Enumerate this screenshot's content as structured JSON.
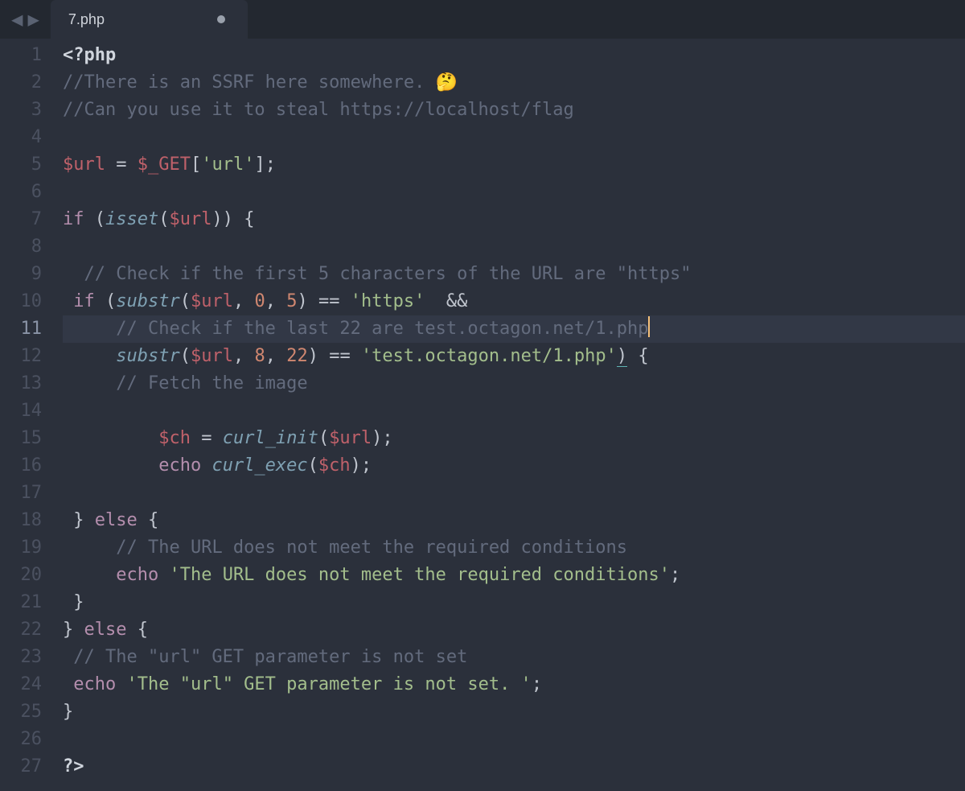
{
  "tab": {
    "filename": "7.php",
    "dirty": true
  },
  "code": {
    "active_line": 11,
    "lines": [
      {
        "n": 1,
        "tokens": [
          [
            "tag",
            "<?php"
          ]
        ]
      },
      {
        "n": 2,
        "tokens": [
          [
            "cm",
            "//There is an SSRF here somewhere. 🤔"
          ]
        ]
      },
      {
        "n": 3,
        "tokens": [
          [
            "cm",
            "//Can you use it to steal https://localhost/flag"
          ]
        ]
      },
      {
        "n": 4,
        "tokens": []
      },
      {
        "n": 5,
        "tokens": [
          [
            "var",
            "$url"
          ],
          [
            "op",
            " = "
          ],
          [
            "var",
            "$_GET"
          ],
          [
            "pn",
            "["
          ],
          [
            "str",
            "'url'"
          ],
          [
            "pn",
            "]"
          ],
          [
            "pn",
            ";"
          ]
        ]
      },
      {
        "n": 6,
        "tokens": []
      },
      {
        "n": 7,
        "tokens": [
          [
            "kw",
            "if"
          ],
          [
            "op",
            " "
          ],
          [
            "pn",
            "("
          ],
          [
            "fn",
            "isset"
          ],
          [
            "pn",
            "("
          ],
          [
            "var",
            "$url"
          ],
          [
            "pn",
            ")"
          ],
          [
            "pn",
            ")"
          ],
          [
            "op",
            " "
          ],
          [
            "brk",
            "{"
          ]
        ]
      },
      {
        "n": 8,
        "tokens": []
      },
      {
        "n": 9,
        "tokens": [
          [
            "pn",
            "  "
          ],
          [
            "cm",
            "// Check if the first 5 characters of the URL are \"https\""
          ]
        ]
      },
      {
        "n": 10,
        "tokens": [
          [
            "pn",
            " "
          ],
          [
            "kw",
            "if"
          ],
          [
            "op",
            " "
          ],
          [
            "pn",
            "("
          ],
          [
            "fn",
            "substr"
          ],
          [
            "pn",
            "("
          ],
          [
            "var",
            "$url"
          ],
          [
            "pn",
            ","
          ],
          [
            "op",
            " "
          ],
          [
            "num",
            "0"
          ],
          [
            "pn",
            ","
          ],
          [
            "op",
            " "
          ],
          [
            "num",
            "5"
          ],
          [
            "pn",
            ")"
          ],
          [
            "op",
            " == "
          ],
          [
            "str",
            "'https'"
          ],
          [
            "op",
            "  "
          ],
          [
            "op",
            "&&"
          ]
        ]
      },
      {
        "n": 11,
        "tokens": [
          [
            "pn",
            "     "
          ],
          [
            "cm",
            "// Check if the last 22 are test.octagon.net/1.php"
          ]
        ],
        "cursor": true
      },
      {
        "n": 12,
        "tokens": [
          [
            "pn",
            "     "
          ],
          [
            "fn",
            "substr"
          ],
          [
            "pn",
            "("
          ],
          [
            "var",
            "$url"
          ],
          [
            "pn",
            ","
          ],
          [
            "op",
            " "
          ],
          [
            "num",
            "8"
          ],
          [
            "pn",
            ","
          ],
          [
            "op",
            " "
          ],
          [
            "num",
            "22"
          ],
          [
            "pn",
            ")"
          ],
          [
            "op",
            " == "
          ],
          [
            "str",
            "'test.octagon.net/1.php'"
          ],
          [
            "brk-u",
            ")"
          ],
          [
            "op",
            " "
          ],
          [
            "brk",
            "{"
          ]
        ]
      },
      {
        "n": 13,
        "tokens": [
          [
            "pn",
            "     "
          ],
          [
            "cm",
            "// Fetch the image"
          ]
        ]
      },
      {
        "n": 14,
        "tokens": []
      },
      {
        "n": 15,
        "tokens": [
          [
            "pn",
            "         "
          ],
          [
            "var",
            "$ch"
          ],
          [
            "op",
            " = "
          ],
          [
            "fn",
            "curl_init"
          ],
          [
            "pn",
            "("
          ],
          [
            "var",
            "$url"
          ],
          [
            "pn",
            ")"
          ],
          [
            "pn",
            ";"
          ]
        ]
      },
      {
        "n": 16,
        "tokens": [
          [
            "pn",
            "         "
          ],
          [
            "kw",
            "echo"
          ],
          [
            "op",
            " "
          ],
          [
            "fn",
            "curl_exec"
          ],
          [
            "pn",
            "("
          ],
          [
            "var",
            "$ch"
          ],
          [
            "pn",
            ")"
          ],
          [
            "pn",
            ";"
          ]
        ]
      },
      {
        "n": 17,
        "tokens": []
      },
      {
        "n": 18,
        "tokens": [
          [
            "pn",
            " "
          ],
          [
            "brk",
            "}"
          ],
          [
            "op",
            " "
          ],
          [
            "kw",
            "else"
          ],
          [
            "op",
            " "
          ],
          [
            "brk",
            "{"
          ]
        ]
      },
      {
        "n": 19,
        "tokens": [
          [
            "pn",
            "     "
          ],
          [
            "cm",
            "// The URL does not meet the required conditions"
          ]
        ]
      },
      {
        "n": 20,
        "tokens": [
          [
            "pn",
            "     "
          ],
          [
            "kw",
            "echo"
          ],
          [
            "op",
            " "
          ],
          [
            "str",
            "'The URL does not meet the required conditions'"
          ],
          [
            "pn",
            ";"
          ]
        ]
      },
      {
        "n": 21,
        "tokens": [
          [
            "pn",
            " "
          ],
          [
            "brk",
            "}"
          ]
        ]
      },
      {
        "n": 22,
        "tokens": [
          [
            "brk",
            "}"
          ],
          [
            "op",
            " "
          ],
          [
            "kw",
            "else"
          ],
          [
            "op",
            " "
          ],
          [
            "brk",
            "{"
          ]
        ]
      },
      {
        "n": 23,
        "tokens": [
          [
            "pn",
            " "
          ],
          [
            "cm",
            "// The \"url\" GET parameter is not set"
          ]
        ]
      },
      {
        "n": 24,
        "tokens": [
          [
            "pn",
            " "
          ],
          [
            "kw",
            "echo"
          ],
          [
            "op",
            " "
          ],
          [
            "str",
            "'The \"url\" GET parameter is not set. '"
          ],
          [
            "pn",
            ";"
          ]
        ]
      },
      {
        "n": 25,
        "tokens": [
          [
            "brk",
            "}"
          ]
        ]
      },
      {
        "n": 26,
        "tokens": []
      },
      {
        "n": 27,
        "tokens": [
          [
            "tag",
            "?>"
          ]
        ]
      }
    ]
  }
}
